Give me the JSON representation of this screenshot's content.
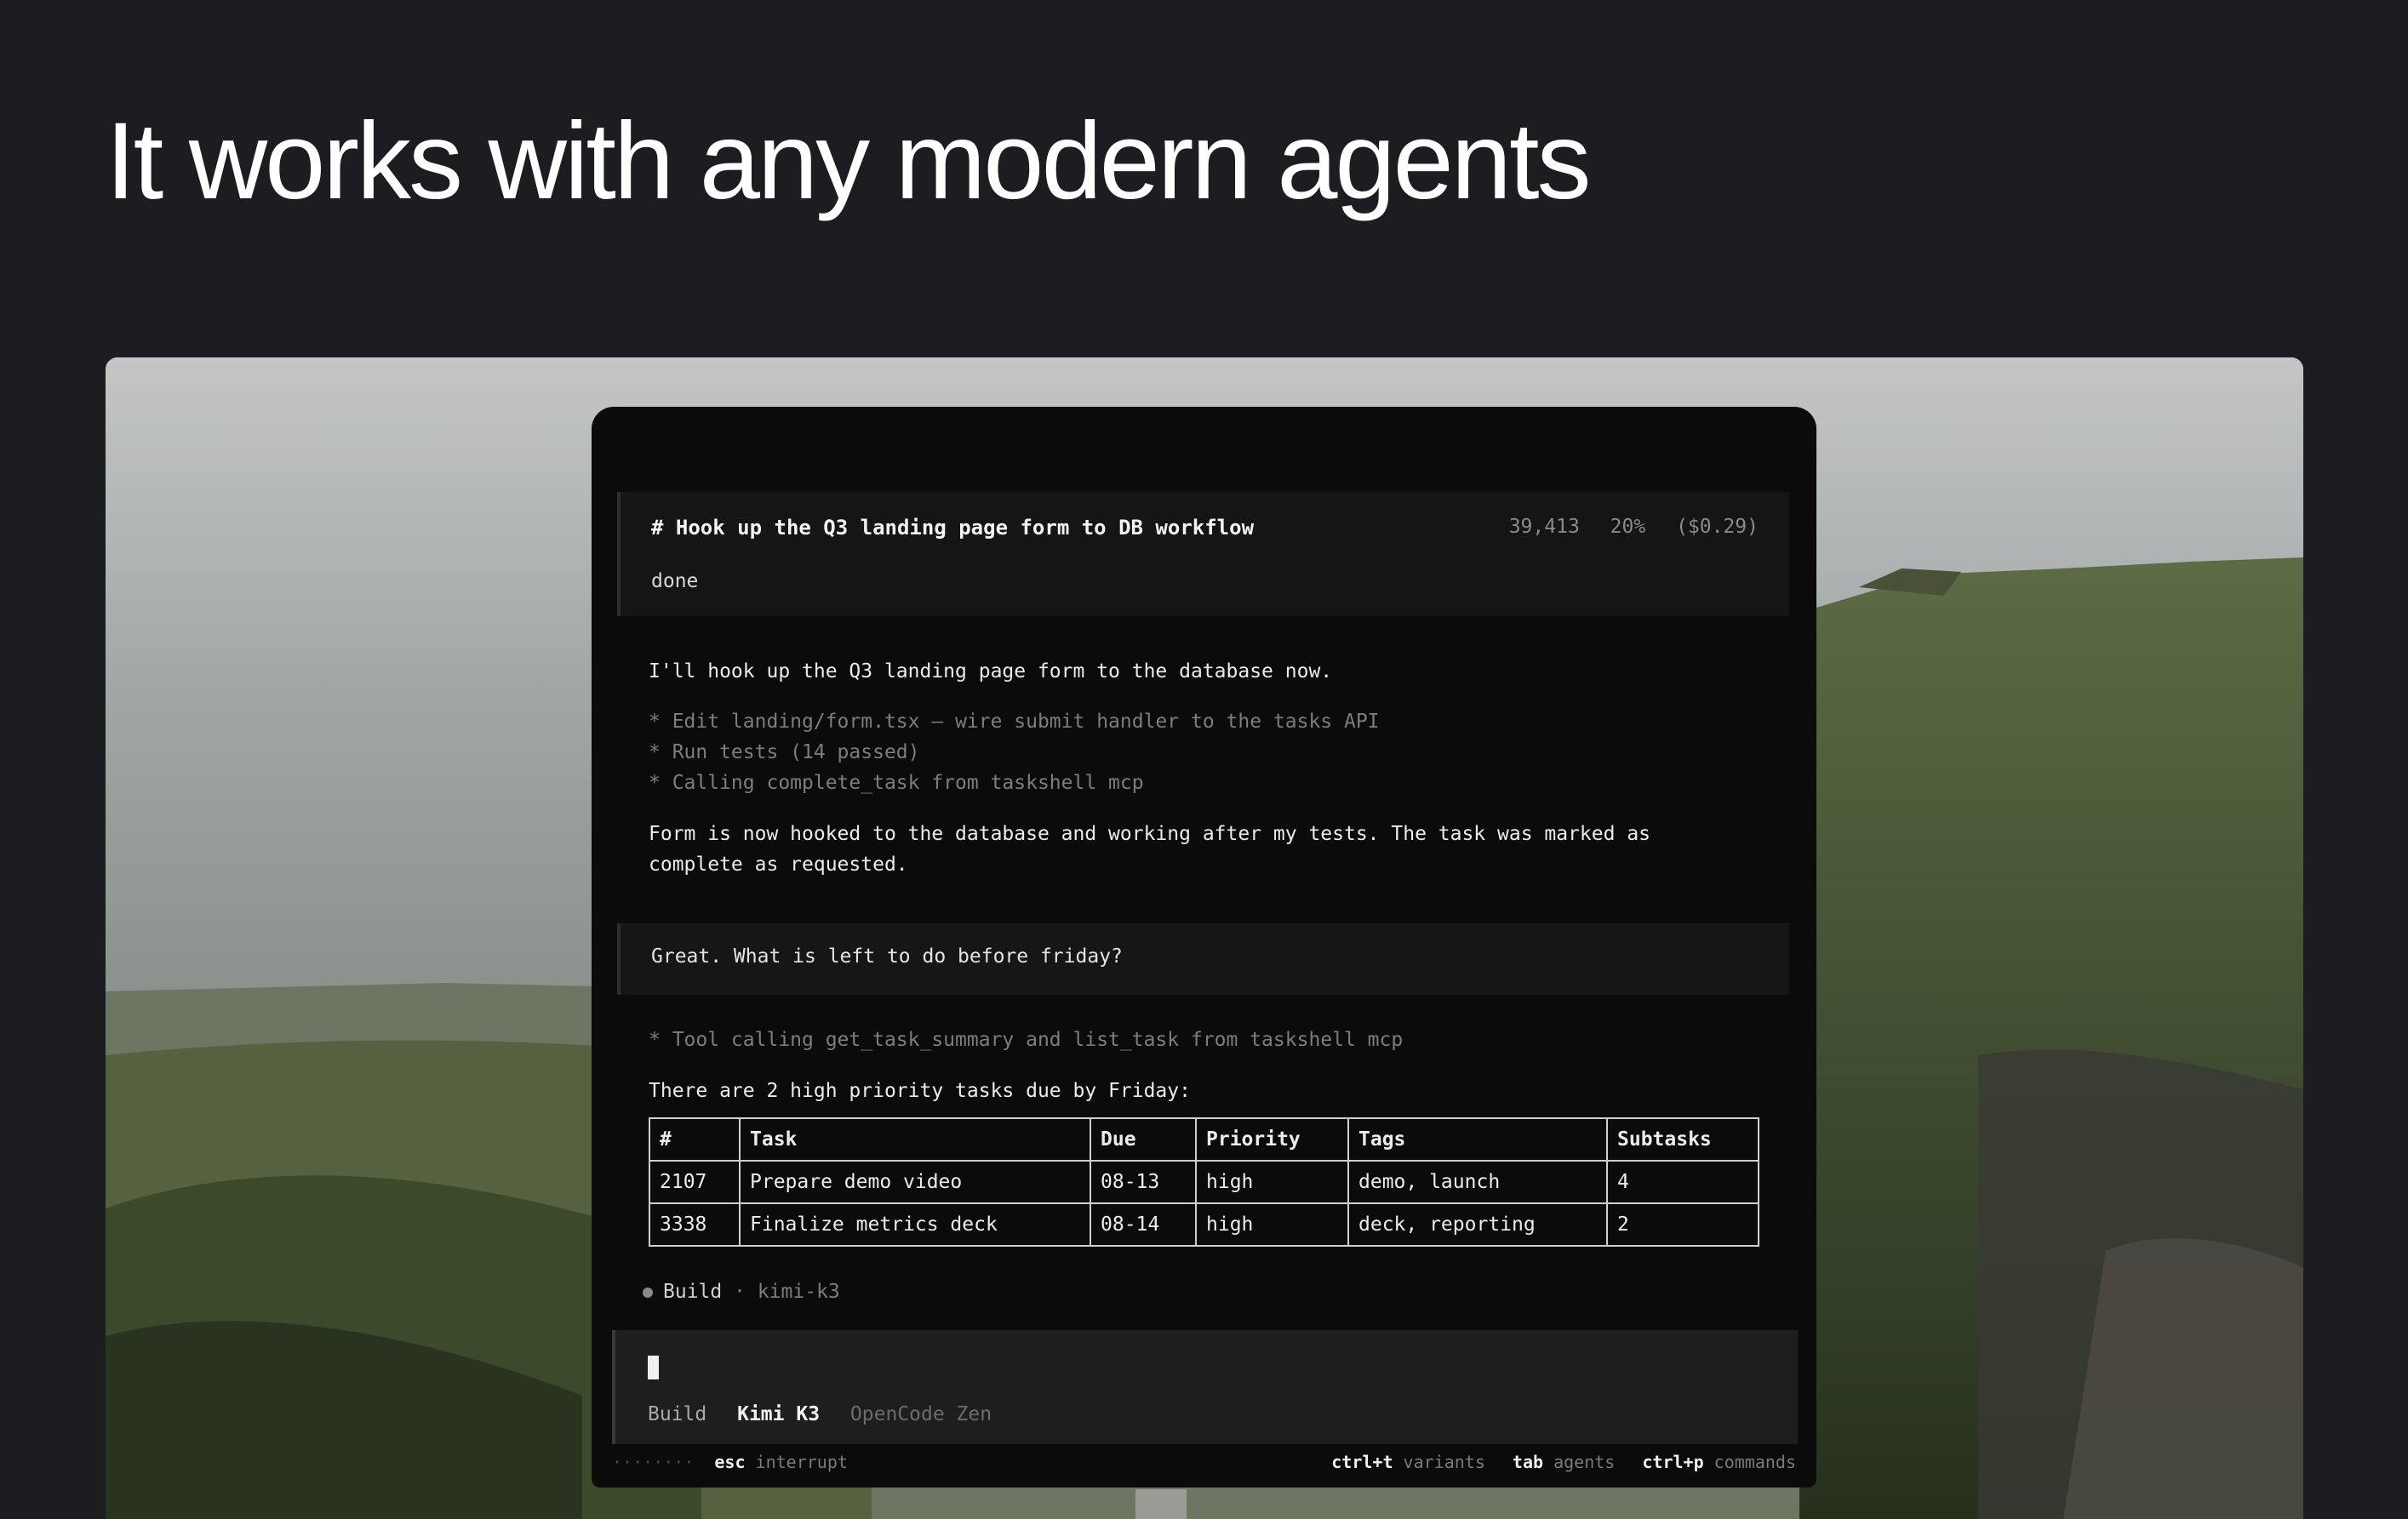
{
  "headline": "It works with any modern agents",
  "session": {
    "title": "# Hook up the Q3 landing page form to DB workflow",
    "tokens": "39,413",
    "context_pct": "20%",
    "cost": "($0.29)",
    "status": "done"
  },
  "messages": {
    "intro": "I'll hook up the Q3 landing page form to the database now.",
    "steps": [
      "* Edit landing/form.tsx — wire submit handler to the tasks API",
      "* Run tests (14 passed)",
      "* Calling complete_task from taskshell mcp"
    ],
    "result_line1": "Form is now hooked to the database and working after my tests. The task was marked as",
    "result_line2": "complete as requested.",
    "user_question": "Great. What is left to do before friday?",
    "tool_call": "* Tool calling get_task_summary and list_task from taskshell mcp",
    "summary": "There are 2 high priority tasks due by Friday:"
  },
  "table": {
    "headers": [
      "#",
      "Task",
      "Due",
      "Priority",
      "Tags",
      "Subtasks"
    ],
    "rows": [
      [
        "2107",
        "Prepare demo video",
        "08-13",
        "high",
        "demo, launch",
        "4"
      ],
      [
        "3338",
        "Finalize metrics deck",
        "08-14",
        "high",
        "deck, reporting",
        "2"
      ]
    ]
  },
  "build_status": {
    "mode": "Build",
    "separator": "·",
    "model": "kimi-k3"
  },
  "input": {
    "mode": "Build",
    "model": "Kimi K3",
    "provider": "OpenCode Zen"
  },
  "footer": {
    "dots": "········",
    "esc_key": "esc",
    "esc_label": "interrupt",
    "variants_key": "ctrl+t",
    "variants_label": "variants",
    "agents_key": "tab",
    "agents_label": "agents",
    "commands_key": "ctrl+p",
    "commands_label": "commands"
  },
  "colors": {
    "page_bg": "#1c1d21",
    "terminal_bg": "#0b0b0c",
    "panel_bg": "#151517",
    "muted_text": "#7d7d80"
  }
}
